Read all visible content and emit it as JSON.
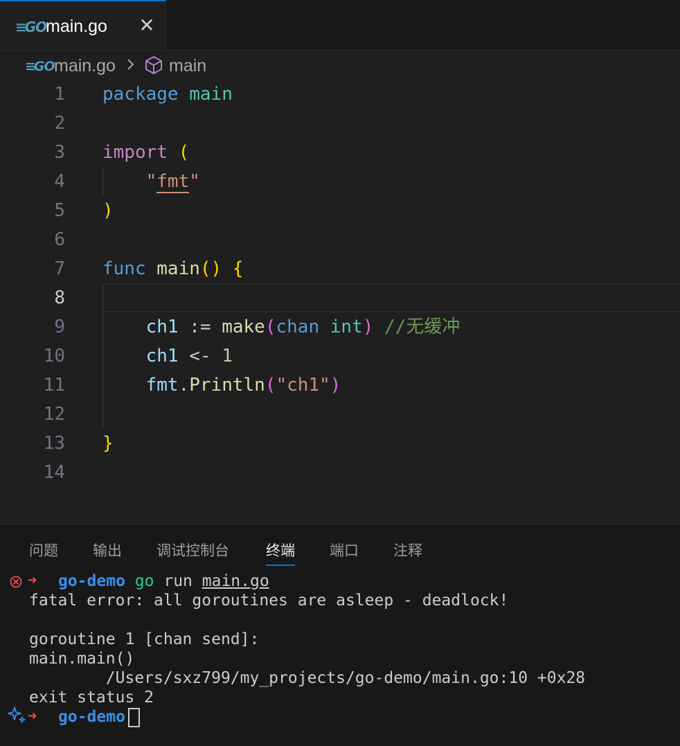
{
  "tabs": [
    {
      "label": "main.go",
      "active": true
    }
  ],
  "breadcrumb": {
    "file": "main.go",
    "symbol": "main"
  },
  "editor": {
    "active_line": 8,
    "line_numbers": [
      "1",
      "2",
      "3",
      "4",
      "5",
      "6",
      "7",
      "8",
      "9",
      "10",
      "11",
      "12",
      "13",
      "14"
    ],
    "code": {
      "l1": {
        "kw": "package",
        "pkg": "main"
      },
      "l3": {
        "kw": "import",
        "paren": "("
      },
      "l4": {
        "q1": "\"",
        "str": "fmt",
        "q2": "\""
      },
      "l5": {
        "paren": ")"
      },
      "l7": {
        "kw": "func",
        "name": "main",
        "parens": "()",
        "brace": "{"
      },
      "l9": {
        "var": "ch1",
        "op": ":=",
        "fn": "make",
        "p1": "(",
        "kw": "chan",
        "type": "int",
        "p2": ")",
        "comment": "//无缓冲"
      },
      "l10": {
        "var": "ch1",
        "op": "<-",
        "num": "1"
      },
      "l11": {
        "pkg": "fmt",
        "dot": ".",
        "fn": "Println",
        "p1": "(",
        "str": "\"ch1\"",
        "p2": ")"
      },
      "l13": {
        "brace": "}"
      }
    }
  },
  "panel": {
    "tabs": [
      "问题",
      "输出",
      "调试控制台",
      "终端",
      "端口",
      "注释"
    ],
    "active_tab": "终端",
    "terminal": {
      "prompt_dir": "go-demo",
      "arrow": "➜",
      "cmd_go": "go",
      "cmd_rest": " run ",
      "cmd_file": "main.go",
      "output": [
        "fatal error: all goroutines are asleep - deadlock!",
        "",
        "goroutine 1 [chan send]:",
        "main.main()",
        "        /Users/sxz799/my_projects/go-demo/main.go:10 +0x28",
        "exit status 2"
      ]
    }
  },
  "colors": {
    "accent": "#0078d4",
    "error": "#f14c4c",
    "prompt": "#3b8eea",
    "go_icon": "#519aba"
  }
}
